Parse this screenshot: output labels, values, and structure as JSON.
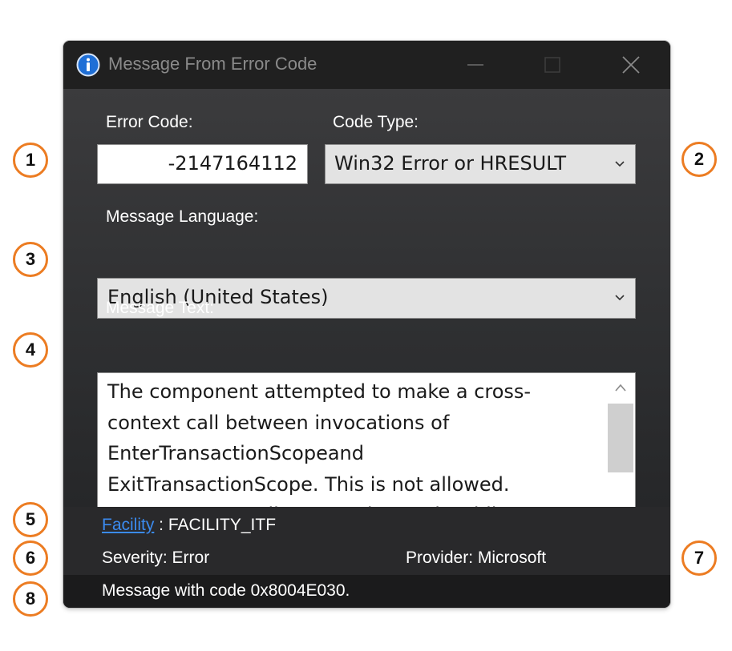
{
  "window": {
    "title": "Message From Error Code"
  },
  "form": {
    "error_code_label": "Error Code:",
    "error_code_value": "-2147164112",
    "code_type_label": "Code Type:",
    "code_type_value": "Win32 Error or HRESULT",
    "language_label": "Message Language:",
    "language_value": "English (United States)",
    "message_label": "Message Text:",
    "message_lines": [
      "The component attempted to make a cross-",
      "context call between invocations of",
      "EnterTransactionScopeand",
      "ExitTransactionScope. This is not allowed.",
      "Cross-context calls cannot be made while"
    ]
  },
  "info": {
    "facility_link": "Facility",
    "facility_value": " : FACILITY_ITF",
    "severity": "Severity: Error",
    "provider": "Provider: Microsoft"
  },
  "status": {
    "text": "Message with code 0x8004E030."
  },
  "callouts": [
    "1",
    "2",
    "3",
    "4",
    "5",
    "6",
    "7",
    "8"
  ],
  "colors": {
    "callout_border": "#ec7c22",
    "link": "#3b8bf0",
    "titlebar": "#202020",
    "info_icon": "#1f6fd6"
  },
  "icons": {
    "app": "info-icon",
    "minimize": "minimize-icon",
    "maximize": "maximize-icon",
    "close": "close-icon",
    "dropdown": "chevron-down-icon",
    "scroll_up": "chevron-up-icon",
    "scroll_down": "chevron-down-icon"
  }
}
